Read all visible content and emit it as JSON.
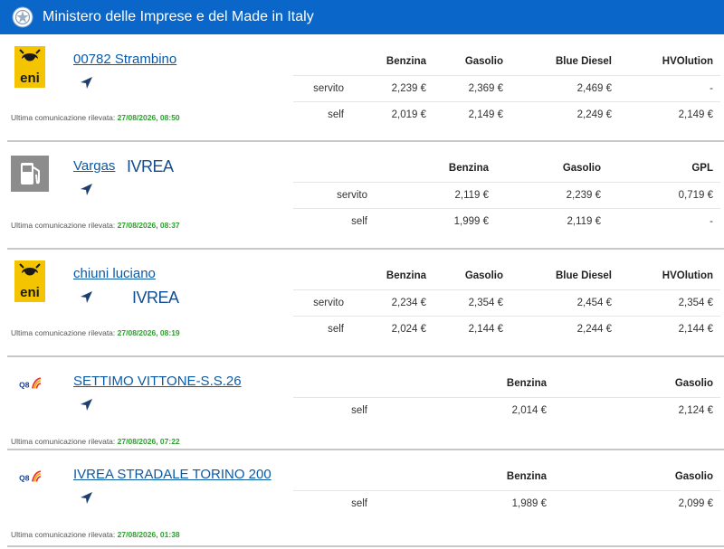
{
  "header": {
    "title": "Ministero delle Imprese e del Made in Italy"
  },
  "last_label": "Ultima comunicazione rilevata:",
  "icons": {
    "emblem": "republic-emblem-icon",
    "navigate": "navigation-arrow-icon",
    "pump": "fuel-pump-icon"
  },
  "colors": {
    "topbar": "#0a66c8",
    "link": "#0b5aa8",
    "timestamp": "#2e9e2e"
  },
  "stations": [
    {
      "name": "00782 Strambino",
      "brand_logo": "eni",
      "timestamp": "27/08/2026, 08:50",
      "columns": [
        "Benzina",
        "Gasolio",
        "Blue Diesel",
        "HVOlution"
      ],
      "rows": [
        {
          "service": "servito",
          "prices": [
            "2,239 €",
            "2,369 €",
            "2,469 €",
            "-"
          ]
        },
        {
          "service": "self",
          "prices": [
            "2,019 €",
            "2,149 €",
            "2,249 €",
            "2,149 €"
          ]
        }
      ]
    },
    {
      "name": "Vargas",
      "brand_logo": "pump",
      "brand_text": "IVREA",
      "timestamp": "27/08/2026, 08:37",
      "columns": [
        "Benzina",
        "Gasolio",
        "GPL"
      ],
      "rows": [
        {
          "service": "servito",
          "prices": [
            "2,119 €",
            "2,239 €",
            "0,719 €"
          ]
        },
        {
          "service": "self",
          "prices": [
            "1,999 €",
            "2,119 €",
            "-"
          ]
        }
      ]
    },
    {
      "name": "chiuni luciano",
      "brand_logo": "eni",
      "brand_text": "IVREA",
      "timestamp": "27/08/2026, 08:19",
      "columns": [
        "Benzina",
        "Gasolio",
        "Blue Diesel",
        "HVOlution"
      ],
      "rows": [
        {
          "service": "servito",
          "prices": [
            "2,234 €",
            "2,354 €",
            "2,454 €",
            "2,354 €"
          ]
        },
        {
          "service": "self",
          "prices": [
            "2,024 €",
            "2,144 €",
            "2,244 €",
            "2,144 €"
          ]
        }
      ]
    },
    {
      "name": "SETTIMO VITTONE-S.S.26",
      "brand_logo": "q8",
      "timestamp": "27/08/2026, 07:22",
      "columns": [
        "Benzina",
        "Gasolio"
      ],
      "rows": [
        {
          "service": "self",
          "prices": [
            "2,014 €",
            "2,124 €"
          ]
        }
      ]
    },
    {
      "name": "IVREA STRADALE TORINO 200",
      "brand_logo": "q8",
      "timestamp": "27/08/2026, 01:38",
      "columns": [
        "Benzina",
        "Gasolio"
      ],
      "rows": [
        {
          "service": "self",
          "prices": [
            "1,989 €",
            "2,099 €"
          ]
        }
      ]
    }
  ]
}
